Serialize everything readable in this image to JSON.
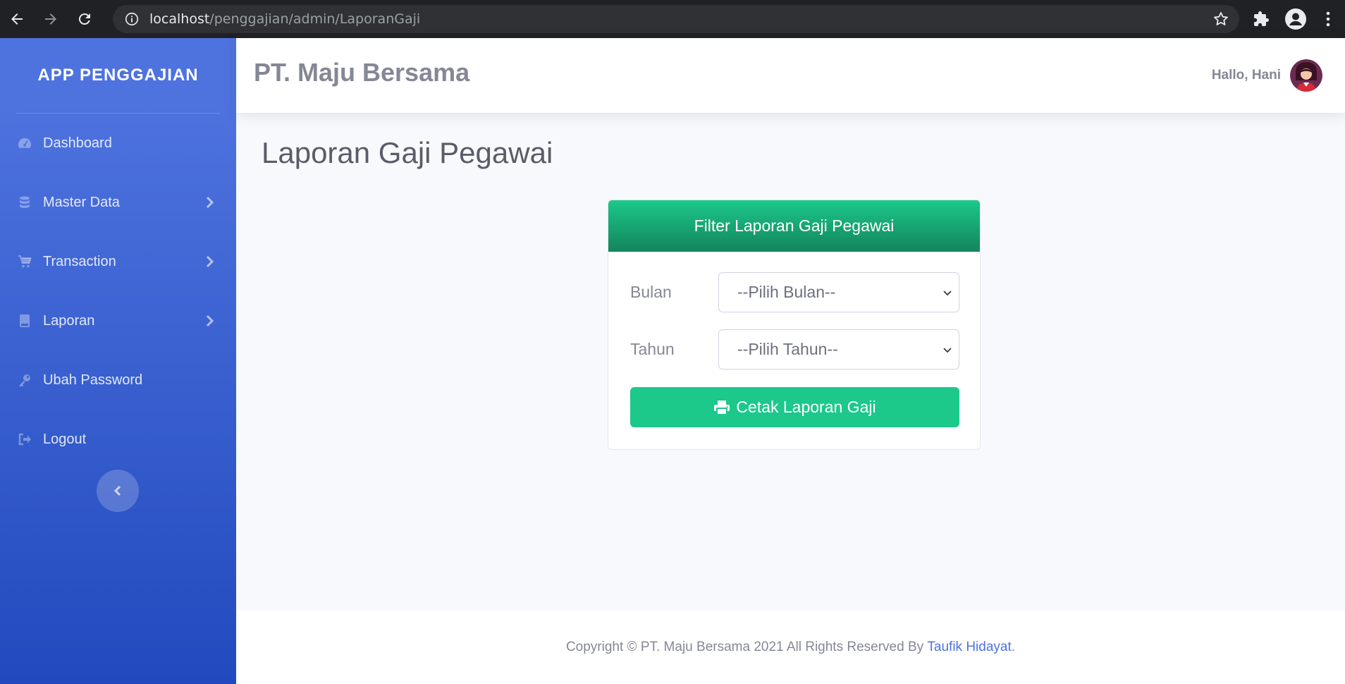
{
  "browser": {
    "url_host": "localhost",
    "url_path": "/penggajian/admin/LaporanGaji"
  },
  "sidebar": {
    "brand": "APP PENGGAJIAN",
    "items": [
      {
        "label": "Dashboard",
        "icon": "tachometer-icon",
        "has_submenu": false
      },
      {
        "label": "Master Data",
        "icon": "database-icon",
        "has_submenu": true
      },
      {
        "label": "Transaction",
        "icon": "shopping-cart-icon",
        "has_submenu": true
      },
      {
        "label": "Laporan",
        "icon": "book-icon",
        "has_submenu": true
      },
      {
        "label": "Ubah Password",
        "icon": "key-icon",
        "has_submenu": false
      },
      {
        "label": "Logout",
        "icon": "sign-out-icon",
        "has_submenu": false
      }
    ]
  },
  "topbar": {
    "company": "PT. Maju Bersama",
    "greeting": "Hallo, Hani"
  },
  "main": {
    "title": "Laporan Gaji Pegawai",
    "card": {
      "header": "Filter Laporan Gaji Pegawai",
      "month_label": "Bulan",
      "month_value": "--Pilih Bulan--",
      "year_label": "Tahun",
      "year_value": "--Pilih Tahun--",
      "print_button": "Cetak Laporan Gaji"
    }
  },
  "footer": {
    "text": "Copyright © PT. Maju Bersama 2021 All Rights Reserved By ",
    "author": "Taufik Hidayat",
    "suffix": "."
  },
  "colors": {
    "primary": "#4e73df",
    "success": "#1cc88a",
    "text_gray": "#858796"
  }
}
